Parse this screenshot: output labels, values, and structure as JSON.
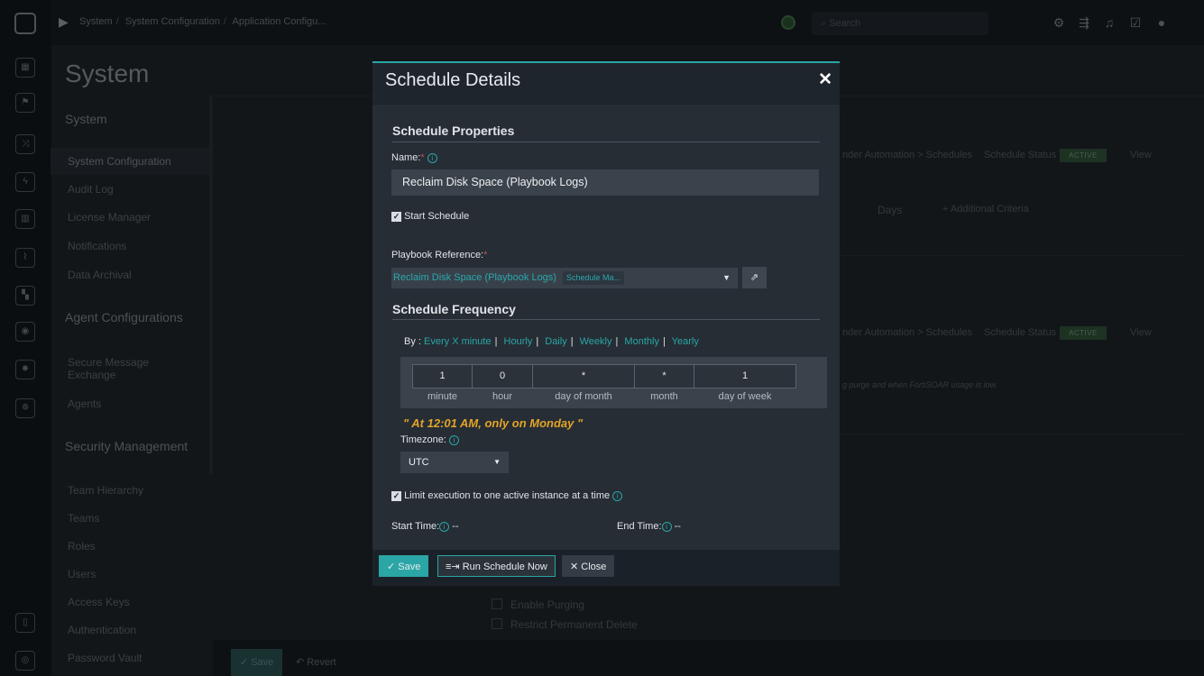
{
  "topbar": {
    "breadcrumb": [
      "System",
      "System Configuration",
      "Application Configu..."
    ],
    "search_placeholder": "Search"
  },
  "sidebar": {
    "page_title": "System",
    "sections": [
      {
        "title": "System",
        "items": [
          "System Configuration",
          "Audit Log",
          "License Manager",
          "Notifications",
          "Data Archival"
        ]
      },
      {
        "title": "Agent Configurations",
        "items": [
          "Secure Message Exchange",
          "Agents"
        ]
      },
      {
        "title": "Security Management",
        "items": [
          "Team Hierarchy",
          "Teams",
          "Roles",
          "Users",
          "Access Keys",
          "Authentication",
          "Password Vault"
        ]
      }
    ]
  },
  "background": {
    "row1_path": "nder Automation > Schedules",
    "status_label": "Schedule Status",
    "status_badge": "ACTIVE",
    "view_link": "View",
    "days_label": "Days",
    "additional_criteria": "+ Additional Criteria",
    "purge_note": "g purge and when FortiSOAR usage is low.",
    "enable_purging": "Enable Purging",
    "restrict_delete": "Restrict Permanent Delete",
    "save_label": "Save",
    "revert_label": "Revert"
  },
  "modal": {
    "title": "Schedule Details",
    "close_symbol": "✕",
    "properties_title": "Schedule Properties",
    "name_label": "Name:",
    "name_value": "Reclaim Disk Space (Playbook Logs)",
    "start_schedule_label": "Start Schedule",
    "playbook_label": "Playbook Reference:",
    "playbook_value": "Reclaim Disk Space (Playbook Logs)",
    "playbook_tag": "Schedule Ma...",
    "frequency_title": "Schedule Frequency",
    "by_label": "By :",
    "by_options": [
      "Every X minute",
      "Hourly",
      "Daily",
      "Weekly",
      "Monthly",
      "Yearly"
    ],
    "cron": [
      {
        "value": "1",
        "label": "minute"
      },
      {
        "value": "0",
        "label": "hour"
      },
      {
        "value": "*",
        "label": "day of month"
      },
      {
        "value": "*",
        "label": "month"
      },
      {
        "value": "1",
        "label": "day of week"
      }
    ],
    "cron_description": "\" At 12:01 AM, only on Monday \"",
    "timezone_label": "Timezone:",
    "timezone_value": "UTC",
    "limit_label": "Limit execution to one active instance at a time",
    "start_time_label": "Start Time:",
    "start_time_value": "--",
    "end_time_label": "End Time:",
    "end_time_value": "--",
    "save_label": "Save",
    "run_label": "Run Schedule Now",
    "close_label": "Close"
  },
  "colors": {
    "accent": "#2aa6a6",
    "cron_description": "#e2a428",
    "background": "#22282e",
    "modal_body": "#262d35"
  }
}
